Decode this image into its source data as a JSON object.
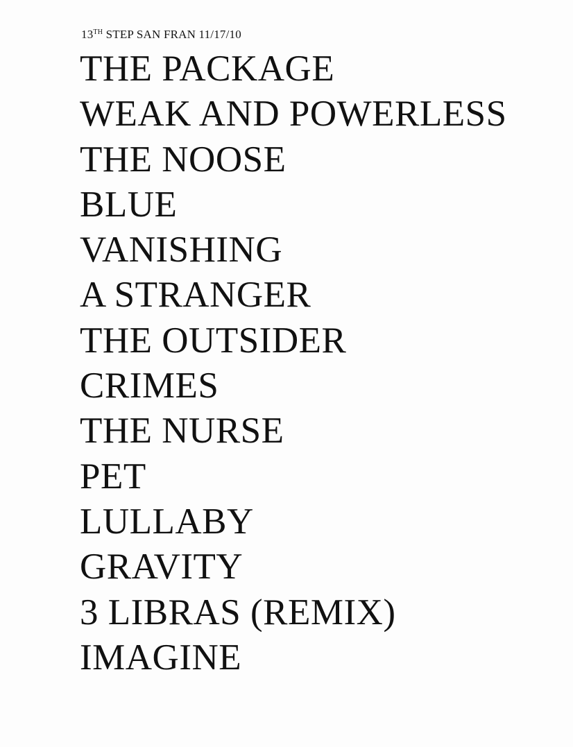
{
  "header": {
    "prefix": "13",
    "superscript": "TH",
    "rest": " STEP SAN FRAN 11/17/10"
  },
  "setlist": [
    "THE PACKAGE",
    "WEAK AND POWERLESS",
    "THE NOOSE",
    "BLUE",
    "VANISHING",
    "A STRANGER",
    "THE OUTSIDER",
    "CRIMES",
    "THE NURSE",
    "PET",
    "LULLABY",
    "GRAVITY",
    "3 LIBRAS (REMIX)",
    "IMAGINE"
  ]
}
